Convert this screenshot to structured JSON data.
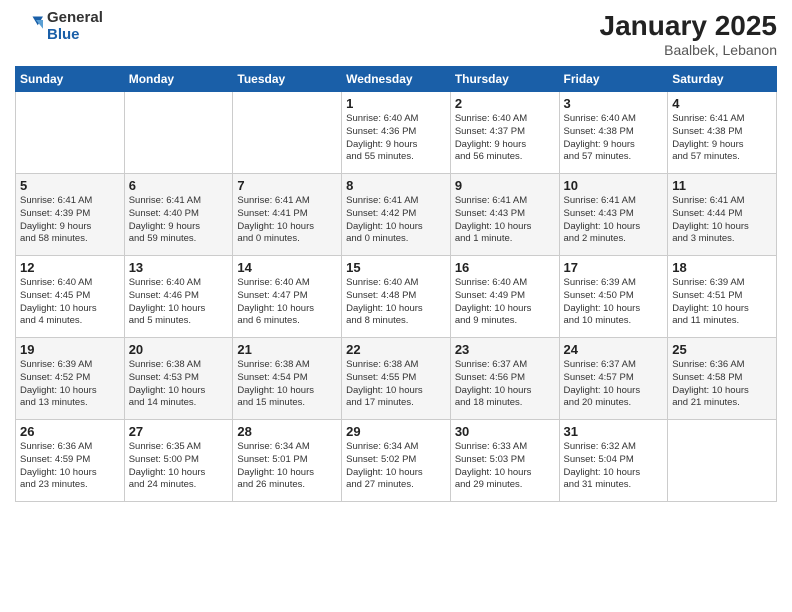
{
  "header": {
    "logo_general": "General",
    "logo_blue": "Blue",
    "month_year": "January 2025",
    "location": "Baalbek, Lebanon"
  },
  "days_of_week": [
    "Sunday",
    "Monday",
    "Tuesday",
    "Wednesday",
    "Thursday",
    "Friday",
    "Saturday"
  ],
  "weeks": [
    [
      {
        "day": "",
        "info": ""
      },
      {
        "day": "",
        "info": ""
      },
      {
        "day": "",
        "info": ""
      },
      {
        "day": "1",
        "info": "Sunrise: 6:40 AM\nSunset: 4:36 PM\nDaylight: 9 hours\nand 55 minutes."
      },
      {
        "day": "2",
        "info": "Sunrise: 6:40 AM\nSunset: 4:37 PM\nDaylight: 9 hours\nand 56 minutes."
      },
      {
        "day": "3",
        "info": "Sunrise: 6:40 AM\nSunset: 4:38 PM\nDaylight: 9 hours\nand 57 minutes."
      },
      {
        "day": "4",
        "info": "Sunrise: 6:41 AM\nSunset: 4:38 PM\nDaylight: 9 hours\nand 57 minutes."
      }
    ],
    [
      {
        "day": "5",
        "info": "Sunrise: 6:41 AM\nSunset: 4:39 PM\nDaylight: 9 hours\nand 58 minutes."
      },
      {
        "day": "6",
        "info": "Sunrise: 6:41 AM\nSunset: 4:40 PM\nDaylight: 9 hours\nand 59 minutes."
      },
      {
        "day": "7",
        "info": "Sunrise: 6:41 AM\nSunset: 4:41 PM\nDaylight: 10 hours\nand 0 minutes."
      },
      {
        "day": "8",
        "info": "Sunrise: 6:41 AM\nSunset: 4:42 PM\nDaylight: 10 hours\nand 0 minutes."
      },
      {
        "day": "9",
        "info": "Sunrise: 6:41 AM\nSunset: 4:43 PM\nDaylight: 10 hours\nand 1 minute."
      },
      {
        "day": "10",
        "info": "Sunrise: 6:41 AM\nSunset: 4:43 PM\nDaylight: 10 hours\nand 2 minutes."
      },
      {
        "day": "11",
        "info": "Sunrise: 6:41 AM\nSunset: 4:44 PM\nDaylight: 10 hours\nand 3 minutes."
      }
    ],
    [
      {
        "day": "12",
        "info": "Sunrise: 6:40 AM\nSunset: 4:45 PM\nDaylight: 10 hours\nand 4 minutes."
      },
      {
        "day": "13",
        "info": "Sunrise: 6:40 AM\nSunset: 4:46 PM\nDaylight: 10 hours\nand 5 minutes."
      },
      {
        "day": "14",
        "info": "Sunrise: 6:40 AM\nSunset: 4:47 PM\nDaylight: 10 hours\nand 6 minutes."
      },
      {
        "day": "15",
        "info": "Sunrise: 6:40 AM\nSunset: 4:48 PM\nDaylight: 10 hours\nand 8 minutes."
      },
      {
        "day": "16",
        "info": "Sunrise: 6:40 AM\nSunset: 4:49 PM\nDaylight: 10 hours\nand 9 minutes."
      },
      {
        "day": "17",
        "info": "Sunrise: 6:39 AM\nSunset: 4:50 PM\nDaylight: 10 hours\nand 10 minutes."
      },
      {
        "day": "18",
        "info": "Sunrise: 6:39 AM\nSunset: 4:51 PM\nDaylight: 10 hours\nand 11 minutes."
      }
    ],
    [
      {
        "day": "19",
        "info": "Sunrise: 6:39 AM\nSunset: 4:52 PM\nDaylight: 10 hours\nand 13 minutes."
      },
      {
        "day": "20",
        "info": "Sunrise: 6:38 AM\nSunset: 4:53 PM\nDaylight: 10 hours\nand 14 minutes."
      },
      {
        "day": "21",
        "info": "Sunrise: 6:38 AM\nSunset: 4:54 PM\nDaylight: 10 hours\nand 15 minutes."
      },
      {
        "day": "22",
        "info": "Sunrise: 6:38 AM\nSunset: 4:55 PM\nDaylight: 10 hours\nand 17 minutes."
      },
      {
        "day": "23",
        "info": "Sunrise: 6:37 AM\nSunset: 4:56 PM\nDaylight: 10 hours\nand 18 minutes."
      },
      {
        "day": "24",
        "info": "Sunrise: 6:37 AM\nSunset: 4:57 PM\nDaylight: 10 hours\nand 20 minutes."
      },
      {
        "day": "25",
        "info": "Sunrise: 6:36 AM\nSunset: 4:58 PM\nDaylight: 10 hours\nand 21 minutes."
      }
    ],
    [
      {
        "day": "26",
        "info": "Sunrise: 6:36 AM\nSunset: 4:59 PM\nDaylight: 10 hours\nand 23 minutes."
      },
      {
        "day": "27",
        "info": "Sunrise: 6:35 AM\nSunset: 5:00 PM\nDaylight: 10 hours\nand 24 minutes."
      },
      {
        "day": "28",
        "info": "Sunrise: 6:34 AM\nSunset: 5:01 PM\nDaylight: 10 hours\nand 26 minutes."
      },
      {
        "day": "29",
        "info": "Sunrise: 6:34 AM\nSunset: 5:02 PM\nDaylight: 10 hours\nand 27 minutes."
      },
      {
        "day": "30",
        "info": "Sunrise: 6:33 AM\nSunset: 5:03 PM\nDaylight: 10 hours\nand 29 minutes."
      },
      {
        "day": "31",
        "info": "Sunrise: 6:32 AM\nSunset: 5:04 PM\nDaylight: 10 hours\nand 31 minutes."
      },
      {
        "day": "",
        "info": ""
      }
    ]
  ]
}
